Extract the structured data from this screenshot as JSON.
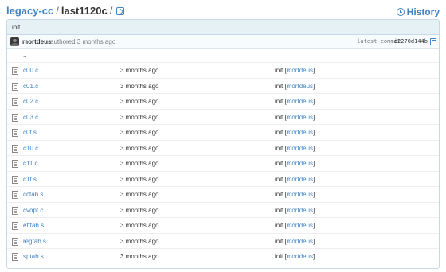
{
  "breadcrumb": {
    "repo": "legacy-cc",
    "separator": "/",
    "folder": "last1120c"
  },
  "history_label": "History",
  "commit": {
    "message": "init",
    "author": "mortdeus",
    "authored_text": "authored 3 months ago",
    "latest_label": "latest commit",
    "sha": "d2270d144b"
  },
  "parent_dir": "..",
  "files": [
    {
      "name": "c00.c",
      "age": "3 months ago",
      "message": "init",
      "author": "mortdeus"
    },
    {
      "name": "c01.c",
      "age": "3 months ago",
      "message": "init",
      "author": "mortdeus"
    },
    {
      "name": "c02.c",
      "age": "3 months ago",
      "message": "init",
      "author": "mortdeus"
    },
    {
      "name": "c03.c",
      "age": "3 months ago",
      "message": "init",
      "author": "mortdeus"
    },
    {
      "name": "c0t.s",
      "age": "3 months ago",
      "message": "init",
      "author": "mortdeus"
    },
    {
      "name": "c10.c",
      "age": "3 months ago",
      "message": "init",
      "author": "mortdeus"
    },
    {
      "name": "c11.c",
      "age": "3 months ago",
      "message": "init",
      "author": "mortdeus"
    },
    {
      "name": "c1t.s",
      "age": "3 months ago",
      "message": "init",
      "author": "mortdeus"
    },
    {
      "name": "cctab.s",
      "age": "3 months ago",
      "message": "init",
      "author": "mortdeus"
    },
    {
      "name": "cvopt.c",
      "age": "3 months ago",
      "message": "init",
      "author": "mortdeus"
    },
    {
      "name": "efftab.s",
      "age": "3 months ago",
      "message": "init",
      "author": "mortdeus"
    },
    {
      "name": "regtab.s",
      "age": "3 months ago",
      "message": "init",
      "author": "mortdeus"
    },
    {
      "name": "sptab.s",
      "age": "3 months ago",
      "message": "init",
      "author": "mortdeus"
    }
  ],
  "colors": {
    "link": "#4183c4",
    "commit_bar": "#e6f1f6",
    "border": "#c6d9e9"
  },
  "icons": {
    "copy": "copy-icon",
    "history": "clock-icon",
    "avatar": "avatar",
    "file": "file-icon"
  }
}
